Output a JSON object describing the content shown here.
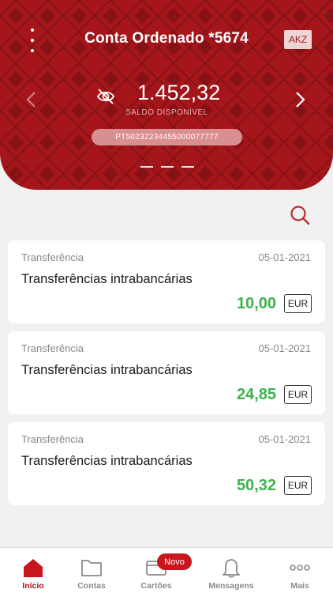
{
  "header": {
    "title": "Conta Ordenado *5674",
    "currency_switch": "AKZ",
    "balance": "1.452,32",
    "balance_label": "SALDO DISPONÍVEL",
    "iban": "PT50232234455000077777",
    "page_count": 3,
    "active_page": 1
  },
  "colors": {
    "brand": "#a5161b",
    "positive": "#3bb34a",
    "badge": "#c8161d"
  },
  "transactions": [
    {
      "type": "Transferência",
      "date": "05-01-2021",
      "description": "Transferências intrabancárias",
      "amount": "10,00",
      "currency": "EUR"
    },
    {
      "type": "Transferência",
      "date": "05-01-2021",
      "description": "Transferências intrabancárias",
      "amount": "24,85",
      "currency": "EUR"
    },
    {
      "type": "Transferência",
      "date": "05-01-2021",
      "description": "Transferências intrabancárias",
      "amount": "50,32",
      "currency": "EUR"
    }
  ],
  "tabbar": {
    "items": [
      {
        "label": "Início",
        "icon": "home-icon",
        "active": true
      },
      {
        "label": "Contas",
        "icon": "folder-icon",
        "active": false
      },
      {
        "label": "Cartões",
        "icon": "card-icon",
        "active": false
      },
      {
        "label": "Mensagens",
        "icon": "bell-icon",
        "active": false
      },
      {
        "label": "Mais",
        "icon": "more-icon",
        "active": false
      }
    ],
    "badge": "Novo"
  }
}
